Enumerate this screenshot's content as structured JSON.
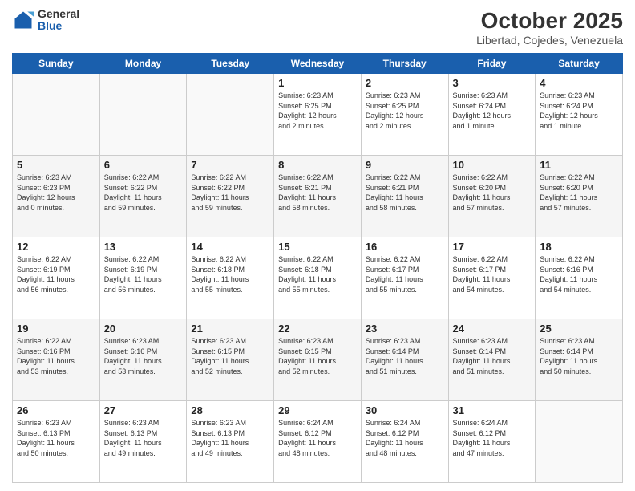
{
  "header": {
    "logo": {
      "general": "General",
      "blue": "Blue"
    },
    "title": "October 2025",
    "subtitle": "Libertad, Cojedes, Venezuela"
  },
  "weekdays": [
    "Sunday",
    "Monday",
    "Tuesday",
    "Wednesday",
    "Thursday",
    "Friday",
    "Saturday"
  ],
  "weeks": [
    [
      {
        "day": "",
        "info": ""
      },
      {
        "day": "",
        "info": ""
      },
      {
        "day": "",
        "info": ""
      },
      {
        "day": "1",
        "info": "Sunrise: 6:23 AM\nSunset: 6:25 PM\nDaylight: 12 hours\nand 2 minutes."
      },
      {
        "day": "2",
        "info": "Sunrise: 6:23 AM\nSunset: 6:25 PM\nDaylight: 12 hours\nand 2 minutes."
      },
      {
        "day": "3",
        "info": "Sunrise: 6:23 AM\nSunset: 6:24 PM\nDaylight: 12 hours\nand 1 minute."
      },
      {
        "day": "4",
        "info": "Sunrise: 6:23 AM\nSunset: 6:24 PM\nDaylight: 12 hours\nand 1 minute."
      }
    ],
    [
      {
        "day": "5",
        "info": "Sunrise: 6:23 AM\nSunset: 6:23 PM\nDaylight: 12 hours\nand 0 minutes."
      },
      {
        "day": "6",
        "info": "Sunrise: 6:22 AM\nSunset: 6:22 PM\nDaylight: 11 hours\nand 59 minutes."
      },
      {
        "day": "7",
        "info": "Sunrise: 6:22 AM\nSunset: 6:22 PM\nDaylight: 11 hours\nand 59 minutes."
      },
      {
        "day": "8",
        "info": "Sunrise: 6:22 AM\nSunset: 6:21 PM\nDaylight: 11 hours\nand 58 minutes."
      },
      {
        "day": "9",
        "info": "Sunrise: 6:22 AM\nSunset: 6:21 PM\nDaylight: 11 hours\nand 58 minutes."
      },
      {
        "day": "10",
        "info": "Sunrise: 6:22 AM\nSunset: 6:20 PM\nDaylight: 11 hours\nand 57 minutes."
      },
      {
        "day": "11",
        "info": "Sunrise: 6:22 AM\nSunset: 6:20 PM\nDaylight: 11 hours\nand 57 minutes."
      }
    ],
    [
      {
        "day": "12",
        "info": "Sunrise: 6:22 AM\nSunset: 6:19 PM\nDaylight: 11 hours\nand 56 minutes."
      },
      {
        "day": "13",
        "info": "Sunrise: 6:22 AM\nSunset: 6:19 PM\nDaylight: 11 hours\nand 56 minutes."
      },
      {
        "day": "14",
        "info": "Sunrise: 6:22 AM\nSunset: 6:18 PM\nDaylight: 11 hours\nand 55 minutes."
      },
      {
        "day": "15",
        "info": "Sunrise: 6:22 AM\nSunset: 6:18 PM\nDaylight: 11 hours\nand 55 minutes."
      },
      {
        "day": "16",
        "info": "Sunrise: 6:22 AM\nSunset: 6:17 PM\nDaylight: 11 hours\nand 55 minutes."
      },
      {
        "day": "17",
        "info": "Sunrise: 6:22 AM\nSunset: 6:17 PM\nDaylight: 11 hours\nand 54 minutes."
      },
      {
        "day": "18",
        "info": "Sunrise: 6:22 AM\nSunset: 6:16 PM\nDaylight: 11 hours\nand 54 minutes."
      }
    ],
    [
      {
        "day": "19",
        "info": "Sunrise: 6:22 AM\nSunset: 6:16 PM\nDaylight: 11 hours\nand 53 minutes."
      },
      {
        "day": "20",
        "info": "Sunrise: 6:23 AM\nSunset: 6:16 PM\nDaylight: 11 hours\nand 53 minutes."
      },
      {
        "day": "21",
        "info": "Sunrise: 6:23 AM\nSunset: 6:15 PM\nDaylight: 11 hours\nand 52 minutes."
      },
      {
        "day": "22",
        "info": "Sunrise: 6:23 AM\nSunset: 6:15 PM\nDaylight: 11 hours\nand 52 minutes."
      },
      {
        "day": "23",
        "info": "Sunrise: 6:23 AM\nSunset: 6:14 PM\nDaylight: 11 hours\nand 51 minutes."
      },
      {
        "day": "24",
        "info": "Sunrise: 6:23 AM\nSunset: 6:14 PM\nDaylight: 11 hours\nand 51 minutes."
      },
      {
        "day": "25",
        "info": "Sunrise: 6:23 AM\nSunset: 6:14 PM\nDaylight: 11 hours\nand 50 minutes."
      }
    ],
    [
      {
        "day": "26",
        "info": "Sunrise: 6:23 AM\nSunset: 6:13 PM\nDaylight: 11 hours\nand 50 minutes."
      },
      {
        "day": "27",
        "info": "Sunrise: 6:23 AM\nSunset: 6:13 PM\nDaylight: 11 hours\nand 49 minutes."
      },
      {
        "day": "28",
        "info": "Sunrise: 6:23 AM\nSunset: 6:13 PM\nDaylight: 11 hours\nand 49 minutes."
      },
      {
        "day": "29",
        "info": "Sunrise: 6:24 AM\nSunset: 6:12 PM\nDaylight: 11 hours\nand 48 minutes."
      },
      {
        "day": "30",
        "info": "Sunrise: 6:24 AM\nSunset: 6:12 PM\nDaylight: 11 hours\nand 48 minutes."
      },
      {
        "day": "31",
        "info": "Sunrise: 6:24 AM\nSunset: 6:12 PM\nDaylight: 11 hours\nand 47 minutes."
      },
      {
        "day": "",
        "info": ""
      }
    ]
  ]
}
